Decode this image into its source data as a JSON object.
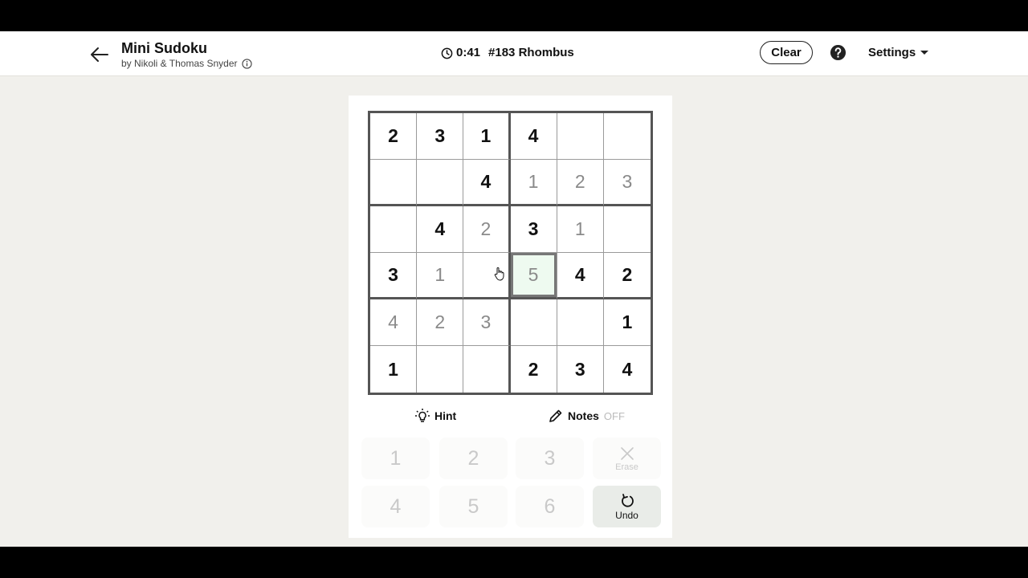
{
  "header": {
    "title": "Mini Sudoku",
    "byline": "by Nikoli & Thomas Snyder",
    "timer": "0:41",
    "puzzle_label": "#183 Rhombus",
    "clear_label": "Clear",
    "settings_label": "Settings"
  },
  "board": {
    "rows": [
      [
        {
          "v": "2",
          "t": "given"
        },
        {
          "v": "3",
          "t": "given"
        },
        {
          "v": "1",
          "t": "given"
        },
        {
          "v": "4",
          "t": "given"
        },
        {
          "v": "",
          "t": "empty"
        },
        {
          "v": "",
          "t": "empty"
        }
      ],
      [
        {
          "v": "",
          "t": "empty"
        },
        {
          "v": "",
          "t": "empty"
        },
        {
          "v": "4",
          "t": "given"
        },
        {
          "v": "1",
          "t": "user"
        },
        {
          "v": "2",
          "t": "user"
        },
        {
          "v": "3",
          "t": "user"
        }
      ],
      [
        {
          "v": "",
          "t": "empty"
        },
        {
          "v": "4",
          "t": "given"
        },
        {
          "v": "2",
          "t": "user"
        },
        {
          "v": "3",
          "t": "given"
        },
        {
          "v": "1",
          "t": "user"
        },
        {
          "v": "",
          "t": "empty"
        }
      ],
      [
        {
          "v": "3",
          "t": "given"
        },
        {
          "v": "1",
          "t": "user"
        },
        {
          "v": "",
          "t": "empty"
        },
        {
          "v": "5",
          "t": "user"
        },
        {
          "v": "4",
          "t": "given"
        },
        {
          "v": "2",
          "t": "given"
        }
      ],
      [
        {
          "v": "4",
          "t": "user"
        },
        {
          "v": "2",
          "t": "user"
        },
        {
          "v": "3",
          "t": "user"
        },
        {
          "v": "",
          "t": "empty"
        },
        {
          "v": "",
          "t": "empty"
        },
        {
          "v": "1",
          "t": "given"
        }
      ],
      [
        {
          "v": "1",
          "t": "given"
        },
        {
          "v": "",
          "t": "empty"
        },
        {
          "v": "",
          "t": "empty"
        },
        {
          "v": "2",
          "t": "given"
        },
        {
          "v": "3",
          "t": "given"
        },
        {
          "v": "4",
          "t": "given"
        }
      ]
    ],
    "selected": [
      3,
      3
    ]
  },
  "tools": {
    "hint_label": "Hint",
    "notes_label": "Notes",
    "notes_state": "OFF"
  },
  "keypad": {
    "keys": [
      "1",
      "2",
      "3",
      "4",
      "5",
      "6"
    ],
    "erase_label": "Erase",
    "undo_label": "Undo"
  },
  "colors": {
    "given_digit": "#111111",
    "user_digit": "#8a8a8a",
    "selected_bg": "#eefaf0",
    "background": "#f1f0ec"
  }
}
